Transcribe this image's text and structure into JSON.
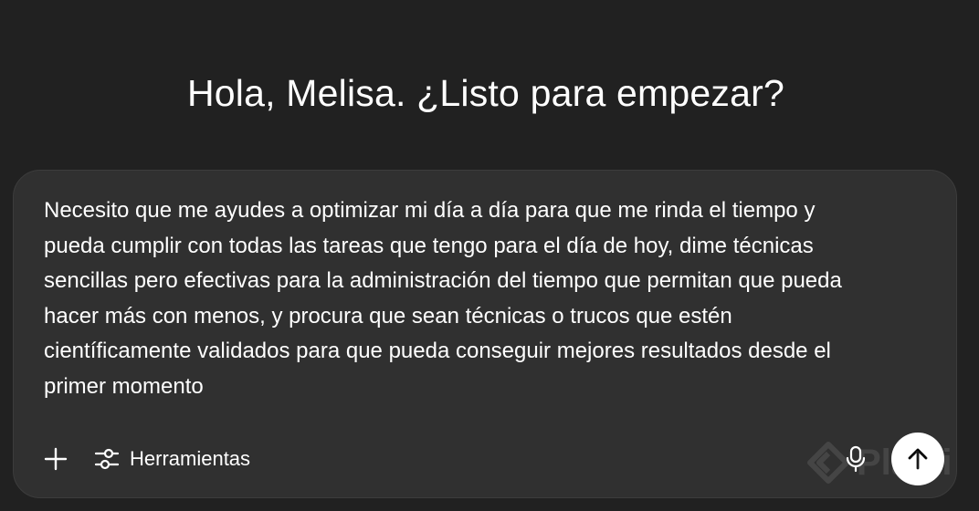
{
  "greeting": "Hola, Melisa. ¿Listo para empezar?",
  "composer": {
    "text": "Necesito que me ayudes a optimizar mi día a día para que me rinda el tiempo y\npueda cumplir con todas las tareas que tengo para el día de hoy, dime técnicas\nsencillas pero efectivas para la administración del tiempo que permitan que pueda\nhacer más con menos, y procura que sean técnicas o trucos que estén\ncientíficamente validados para que pueda conseguir mejores resultados desde el\nprimer momento"
  },
  "toolbar": {
    "add_icon": "plus-icon",
    "tools_icon": "sliders-icon",
    "tools_label": "Herramientas",
    "mic_icon": "microphone-icon",
    "send_icon": "arrow-up-icon"
  },
  "watermark": {
    "text": "Platzi"
  },
  "colors": {
    "background": "#212121",
    "composer_bg": "#303030",
    "text": "#ffffff",
    "send_bg": "#ffffff",
    "send_icon": "#000000"
  }
}
